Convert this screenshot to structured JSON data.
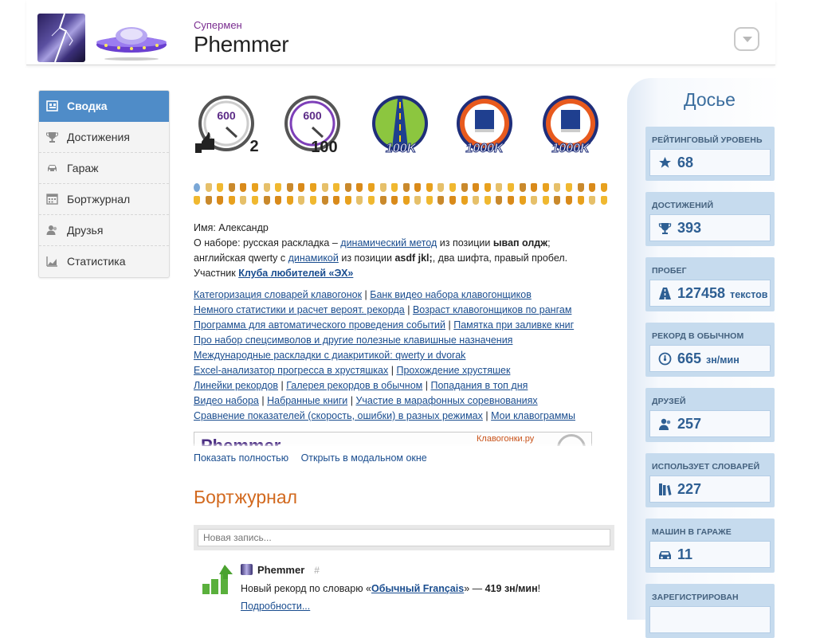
{
  "header": {
    "subtitle": "Супермен",
    "username": "Phemmer"
  },
  "nav": {
    "items": [
      {
        "label": "Сводка",
        "icon": "summary-icon",
        "active": true
      },
      {
        "label": "Достижения",
        "icon": "trophy-icon"
      },
      {
        "label": "Гараж",
        "icon": "car-icon"
      },
      {
        "label": "Бортжурнал",
        "icon": "calendar-icon"
      },
      {
        "label": "Друзья",
        "icon": "friends-icon"
      },
      {
        "label": "Статистика",
        "icon": "chart-icon"
      }
    ]
  },
  "badges": [
    {
      "top": "600",
      "bottom": "2",
      "style": "speed-thumb"
    },
    {
      "top": "600",
      "bottom": "100",
      "style": "speed"
    },
    {
      "bottom": "100K",
      "style": "road"
    },
    {
      "bottom": "1000K",
      "style": "book-orange"
    },
    {
      "bottom": "1000K",
      "style": "book-blue"
    }
  ],
  "about": {
    "name_line": "Имя: Александр",
    "line2_a": "О наборе: русская раскладка –",
    "line2_link": "динамический метод",
    "line2_b": "из позиции",
    "line2_bold": "ывап олдж",
    "line2_c": ";",
    "line3_a": "английская qwerty с",
    "line3_link": "динамикой",
    "line3_b": "из позиции",
    "line3_bold": "asdf jkl;",
    "line3_c": ", два шифта, правый пробел.",
    "line4_a": "Участник",
    "line4_link": "Клуба любителей «ЭХ»"
  },
  "links": {
    "l1a": "Категоризация словарей клавогонок",
    "l1b": "Банк видео набора клавогонщиков",
    "l2a": "Немного статистики и расчет вероят. рекорда",
    "l2b": "Возраст клавогонщиков по рангам",
    "l3a": "Программа для автоматического проведения событий",
    "l3b": "Памятка при заливке книг",
    "l4a": "Про набор спецсимволов и другие полезные клавишные назначения",
    "l5a": "Международные раскладки с диакритикой: qwerty и dvorak",
    "l6a": "Excel-анализатор прогресса в хрустяшках",
    "l6b": "Прохождение хрустяшек",
    "l7a": "Линейки рекордов",
    "l7b": "Галерея рекордов в обычном",
    "l7c": "Попадания в топ дня",
    "l8a": "Видео набора",
    "l8b": "Набранные книги",
    "l8c": "Участие в марафонных соревнованиях",
    "l9a": "Сравнение показателей (скорость, ошибки) в разных режимах",
    "l9b": "Мои клавограммы",
    "sep": "|"
  },
  "preview": {
    "name": "Phemmer",
    "site": "Клавогонки.ру",
    "show_full": "Показать полностью",
    "open_modal": "Открыть в модальном окне"
  },
  "journal": {
    "title": "Бортжурнал",
    "placeholder": "Новая запись...",
    "post_author": "Phemmer",
    "post_hash": "#",
    "post_text_a": "Новый рекорд по словарю «",
    "post_link": "Обычный Français",
    "post_text_b": "» —",
    "post_bold": "419 зн/мин",
    "post_text_c": "!",
    "more": "Подробности..."
  },
  "dossier": {
    "title": "Досье",
    "cards": [
      {
        "label": "РЕЙТИНГОВЫЙ УРОВЕНЬ",
        "value": "68",
        "unit": "",
        "icon": "star-icon"
      },
      {
        "label": "ДОСТИЖЕНИЙ",
        "value": "393",
        "unit": "",
        "icon": "trophy-icon"
      },
      {
        "label": "ПРОБЕГ",
        "value": "127458",
        "unit": "текстов",
        "icon": "road-icon"
      },
      {
        "label": "РЕКОРД В ОБЫЧНОМ",
        "value": "665",
        "unit": "зн/мин",
        "icon": "speedometer-icon"
      },
      {
        "label": "ДРУЗЕЙ",
        "value": "257",
        "unit": "",
        "icon": "friends-icon"
      },
      {
        "label": "ИСПОЛЬЗУЕТ СЛОВАРЕЙ",
        "value": "227",
        "unit": "",
        "icon": "books-icon"
      },
      {
        "label": "МАШИН В ГАРАЖЕ",
        "value": "11",
        "unit": "",
        "icon": "car-icon"
      },
      {
        "label": "ЗАРЕГИСТРИРОВАН",
        "value": "",
        "unit": "",
        "icon": ""
      }
    ]
  },
  "colors": {
    "accent": "#4f8cc8",
    "link": "#1a4d8f",
    "journal_title": "#d2691e",
    "dossier_card": "#c6dbee"
  }
}
